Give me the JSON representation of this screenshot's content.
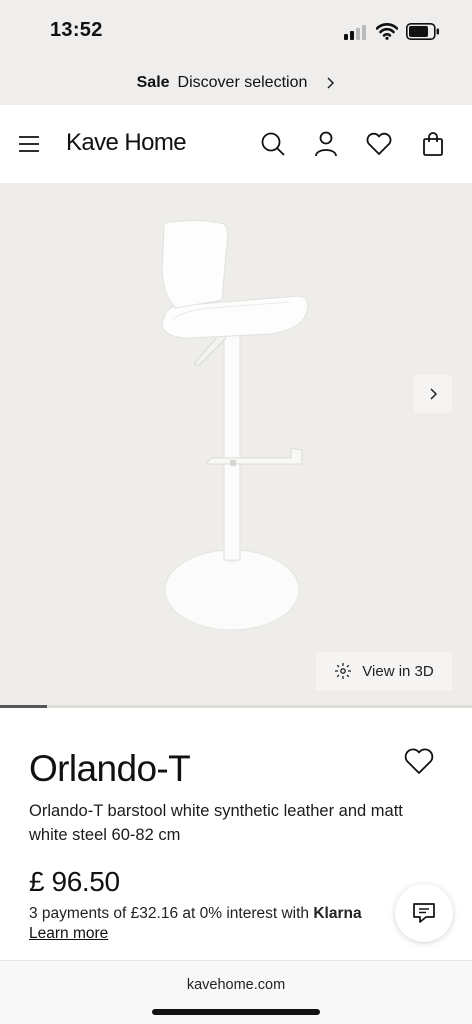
{
  "status_bar": {
    "time": "13:52",
    "icons": [
      "cellular-signal-icon",
      "wifi-icon",
      "battery-icon"
    ]
  },
  "sale_banner": {
    "bold_label": "Sale",
    "link_label": "Discover selection",
    "icon": "chevron-right-icon"
  },
  "header": {
    "logo": "Kave Home",
    "icons": [
      "hamburger-menu-icon",
      "search-icon",
      "user-icon",
      "heart-icon",
      "shopping-bag-icon"
    ]
  },
  "gallery": {
    "image_subject": "white barstool",
    "next_icon": "chevron-right-icon",
    "view_3d_label": "View in 3D",
    "view_3d_icon": "cube-3d-icon",
    "progress_fraction": 0.1
  },
  "product": {
    "title": "Orlando-T",
    "description": "Orlando-T barstool white synthetic leather and matt white steel 60-82 cm",
    "price": "£ 96.50",
    "installments_text": "3 payments of £32.16 at 0% interest with ",
    "installments_provider": "Klarna",
    "learn_more": "Learn more",
    "favourite_icon": "heart-icon",
    "chat_icon": "chat-bubble-icon"
  },
  "browser": {
    "url": "kavehome.com"
  },
  "colors": {
    "banner_bg": "#efeeec",
    "gallery_bg": "#efedea",
    "text": "#111111"
  }
}
